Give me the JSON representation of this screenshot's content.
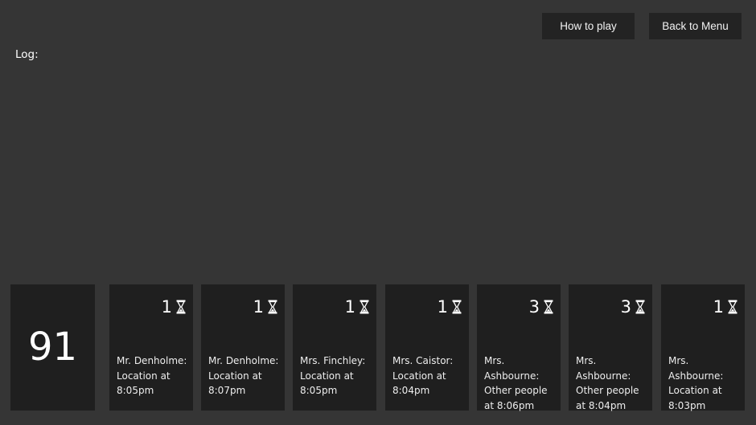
{
  "header": {
    "how_to_play": "How to play",
    "back_to_menu": "Back to Menu"
  },
  "log": {
    "label": "Log:"
  },
  "time_card": {
    "value": "91"
  },
  "cards": [
    {
      "cost": "1",
      "icon": "hourglass-icon",
      "text": "Mr. Denholme: Location at 8:05pm"
    },
    {
      "cost": "1",
      "icon": "hourglass-icon",
      "text": "Mr. Denholme: Location at 8:07pm"
    },
    {
      "cost": "1",
      "icon": "hourglass-icon",
      "text": "Mrs. Finchley: Location at 8:05pm"
    },
    {
      "cost": "1",
      "icon": "hourglass-icon",
      "text": "Mrs. Caistor: Location at 8:04pm"
    },
    {
      "cost": "3",
      "icon": "hourglass-icon",
      "text": "Mrs. Ashbourne: Other people at 8:06pm"
    },
    {
      "cost": "3",
      "icon": "hourglass-icon",
      "text": "Mrs. Ashbourne: Other people at 8:04pm"
    },
    {
      "cost": "1",
      "icon": "hourglass-icon",
      "text": "Mrs. Ashbourne: Location at 8:03pm"
    }
  ]
}
